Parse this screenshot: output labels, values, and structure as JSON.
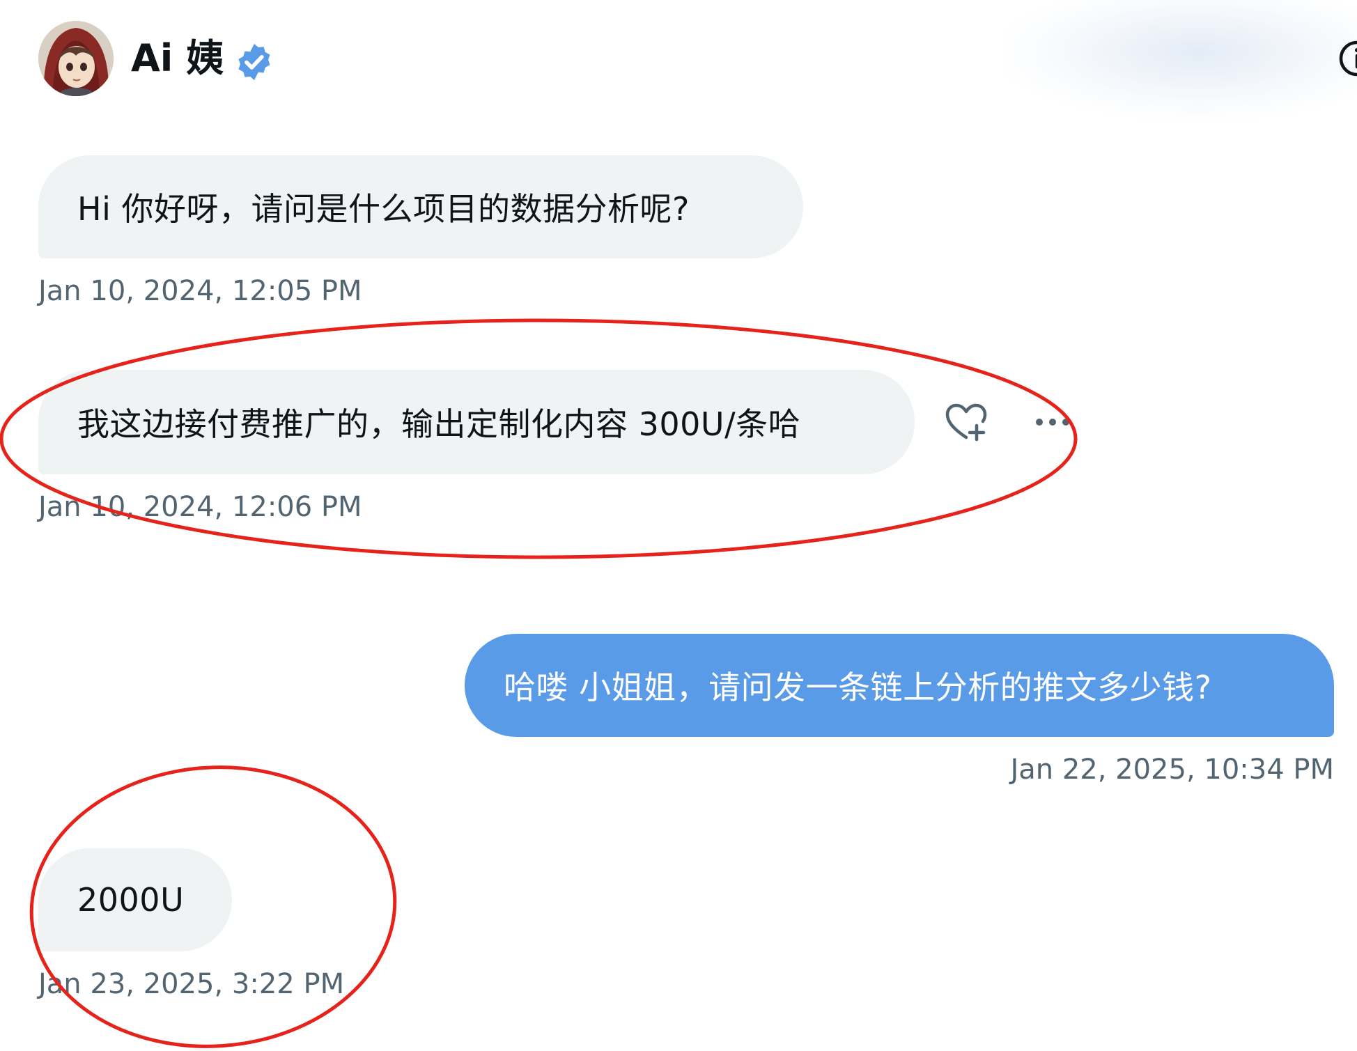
{
  "header": {
    "name": "Ai 姨",
    "avatar_icon": "anime-avatar-icon",
    "verified_icon": "verified-badge-icon",
    "info_icon": "info-icon"
  },
  "messages": [
    {
      "direction": "incoming",
      "text": "Hi 你好呀，请问是什么项目的数据分析呢?",
      "timestamp": "Jan 10, 2024, 12:05 PM"
    },
    {
      "direction": "incoming",
      "text": "我这边接付费推广的，输出定制化内容 300U/条哈",
      "timestamp": "Jan 10, 2024, 12:06 PM"
    },
    {
      "direction": "outgoing",
      "text": "哈喽 小姐姐，请问发一条链上分析的推文多少钱?",
      "timestamp": "Jan 22, 2025, 10:34 PM"
    },
    {
      "direction": "incoming",
      "text": "2000U",
      "timestamp": "Jan 23, 2025, 3:22 PM"
    }
  ],
  "hover_actions": {
    "react_icon": "heart-plus-icon",
    "more_icon": "more-horizontal-icon"
  },
  "colors": {
    "incoming_bubble": "#eff3f4",
    "outgoing_bubble": "#5a9be8",
    "timestamp_text": "#536471",
    "verified_badge": "#5a9be8",
    "annotation_circle": "#e5231b"
  }
}
